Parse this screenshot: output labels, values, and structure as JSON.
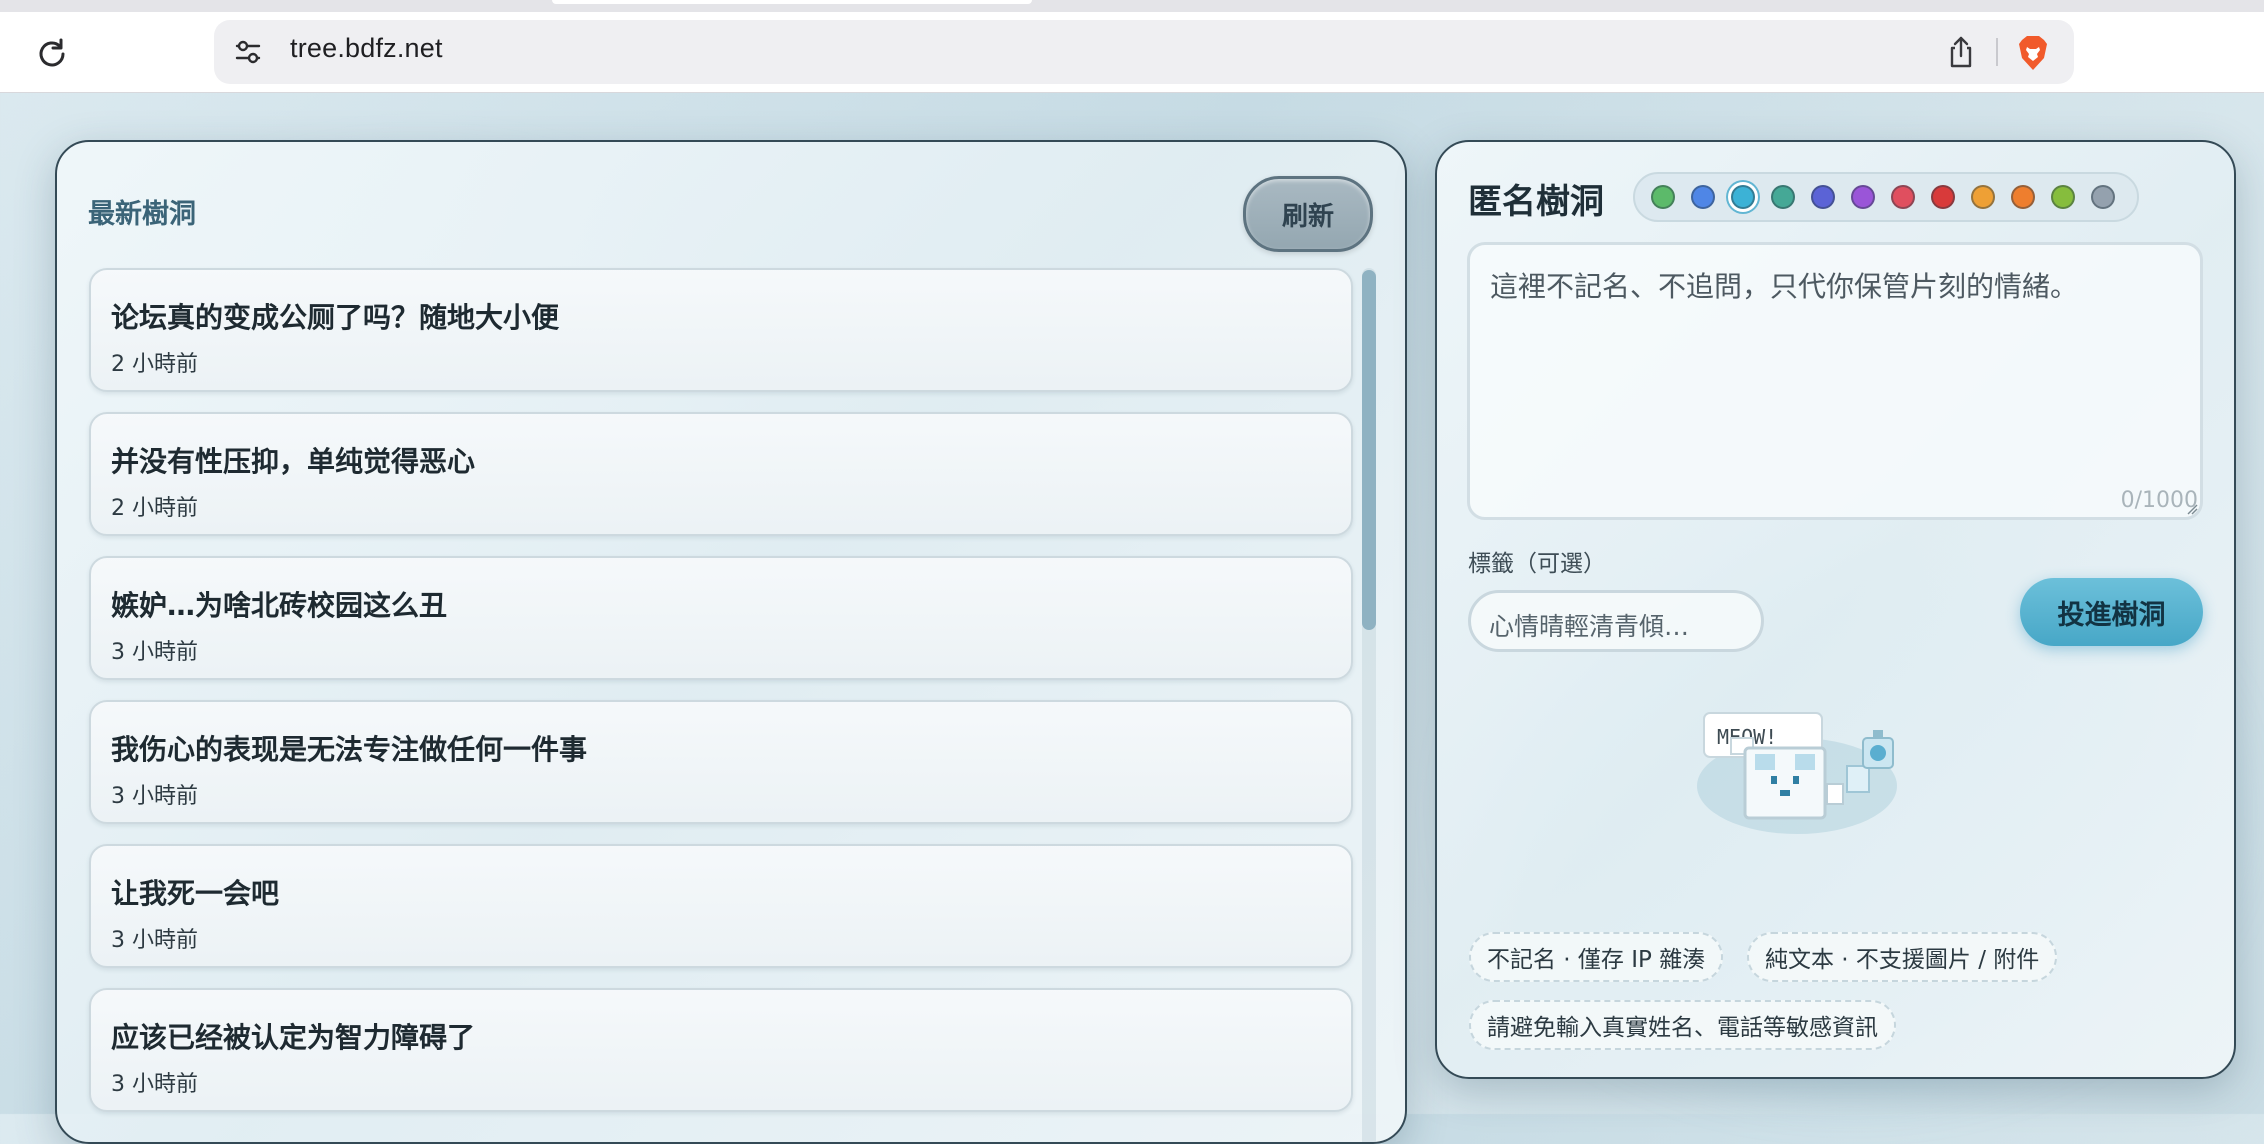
{
  "browser": {
    "url": "tree.bdfz.net"
  },
  "left_panel": {
    "title": "最新樹洞",
    "refresh_label": "刷新",
    "posts": [
      {
        "text": "论坛真的变成公厕了吗？随地大小便",
        "time": "2 小時前"
      },
      {
        "text": "并没有性压抑，单纯觉得恶心",
        "time": "2 小時前"
      },
      {
        "text": "嫉妒…为啥北砖校园这么丑",
        "time": "3 小時前"
      },
      {
        "text": "我伤心的表现是无法专注做任何一件事",
        "time": "3 小時前"
      },
      {
        "text": "让我死一会吧",
        "time": "3 小時前"
      },
      {
        "text": "应该已经被认定为智力障碍了",
        "time": "3 小時前"
      }
    ]
  },
  "right_panel": {
    "title": "匿名樹洞",
    "colors": [
      "#5cba6a",
      "#4f86e6",
      "#3cb2d6",
      "#45a896",
      "#5b63d6",
      "#9a55d8",
      "#e04f5f",
      "#d83a3a",
      "#eea035",
      "#ee7e2e",
      "#86bd3d",
      "#94a1ae"
    ],
    "selected_color_index": 2,
    "textarea_placeholder": "這裡不記名、不追問，只代你保管片刻的情緒。",
    "char_count": "0/1000",
    "tag_label": "標籤（可選）",
    "tag_placeholder": "心情晴輕清青傾…",
    "submit_label": "投進樹洞",
    "mascot_text": "MEOW!",
    "notes": [
      "不記名 · 僅存 IP 雜湊",
      "純文本 · 不支援圖片 / 附件",
      "請避免輸入真實姓名、電話等敏感資訊"
    ]
  }
}
